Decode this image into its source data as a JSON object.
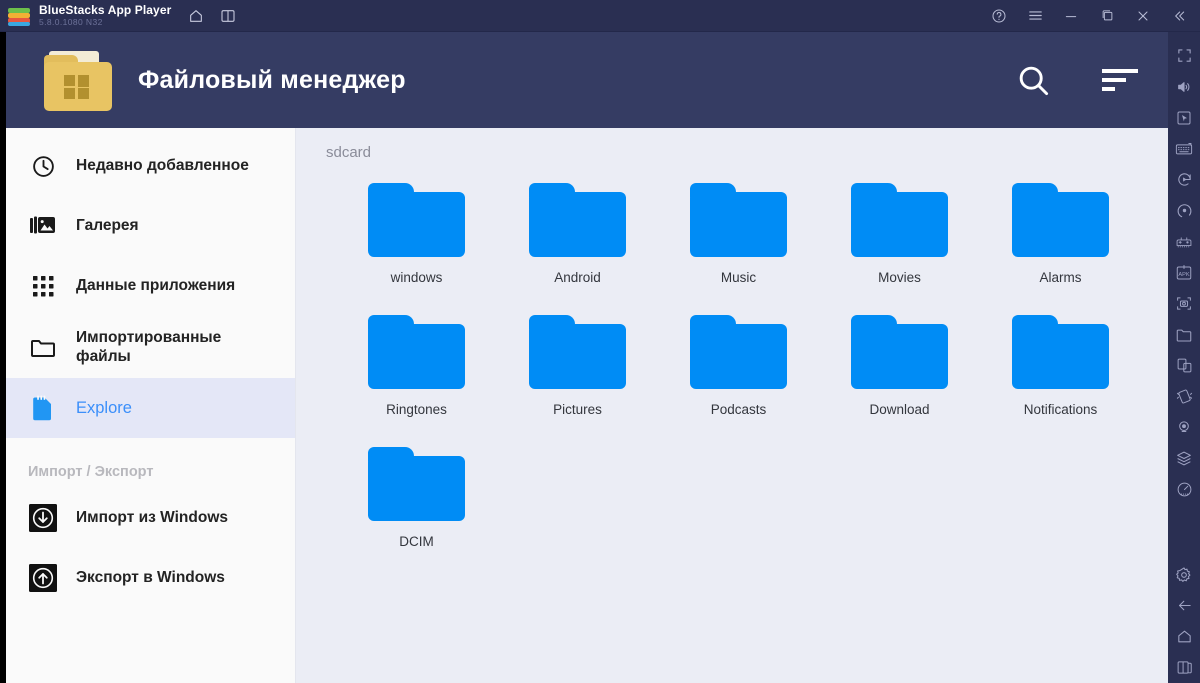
{
  "window": {
    "app_name": "BlueStacks App Player",
    "version": "5.8.0.1080  N32",
    "titlebar_icons": [
      "home-icon",
      "multi-instance-icon"
    ],
    "titlebar_right_icons": [
      "help-icon",
      "menu-icon",
      "minimize-icon",
      "maximize-icon",
      "close-icon",
      "collapse-icon"
    ],
    "colors": {
      "titlebar_bg": "#2a2f52",
      "app_header_bg": "#353c63",
      "content_bg": "#ebedf5",
      "sidebar_bg": "#fafafa",
      "accent_blue": "#3b8ffa",
      "folder_blue": "#008cf5",
      "app_icon_gold": "#e8c463"
    }
  },
  "app_header": {
    "title": "Файловый менеджер",
    "icon": "windows-folder-icon",
    "actions": [
      {
        "name": "search-button",
        "icon": "search-icon"
      },
      {
        "name": "sort-button",
        "icon": "sort-icon"
      }
    ]
  },
  "sidebar": {
    "items": [
      {
        "label": "Недавно добавленное",
        "icon": "clock-icon",
        "active": false
      },
      {
        "label": "Галерея",
        "icon": "gallery-icon",
        "active": false
      },
      {
        "label": "Данные приложения",
        "icon": "app-grid-icon",
        "active": false
      },
      {
        "label": "Импортированные файлы",
        "icon": "folder-icon",
        "active": false
      },
      {
        "label": "Explore",
        "icon": "sdcard-icon",
        "active": true
      }
    ],
    "section_header": "Импорт / Экспорт",
    "transfer_items": [
      {
        "label": "Импорт из Windows",
        "icon": "import-download-icon"
      },
      {
        "label": "Экспорт в Windows",
        "icon": "export-upload-icon"
      }
    ]
  },
  "content": {
    "breadcrumb": "sdcard",
    "folders": [
      {
        "name": "windows"
      },
      {
        "name": "Android"
      },
      {
        "name": "Music"
      },
      {
        "name": "Movies"
      },
      {
        "name": "Alarms"
      },
      {
        "name": "Ringtones"
      },
      {
        "name": "Pictures"
      },
      {
        "name": "Podcasts"
      },
      {
        "name": "Download"
      },
      {
        "name": "Notifications"
      },
      {
        "name": "DCIM"
      }
    ]
  },
  "right_toolbar": {
    "top_icons": [
      "fullscreen-icon",
      "volume-icon",
      "cursor-icon",
      "keyboard-icon",
      "rotate-icon",
      "record-icon",
      "game-controls-icon",
      "apk-install-icon",
      "screenshot-icon",
      "media-manager-icon",
      "multi-instance-icon",
      "shake-icon",
      "location-icon",
      "macro-icon",
      "performance-icon"
    ],
    "bottom_icons": [
      "settings-icon",
      "back-icon",
      "home-icon",
      "recents-icon"
    ]
  }
}
